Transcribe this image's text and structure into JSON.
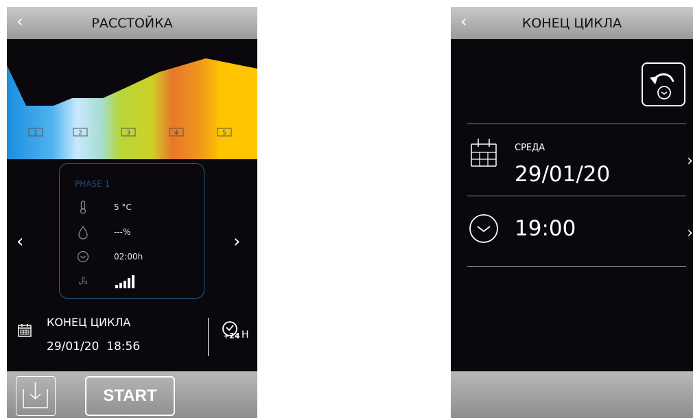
{
  "left_screen": {
    "header": {
      "back_icon": "chevron-left-icon",
      "title": "РАССТОЙКА"
    },
    "profile": {
      "phases": [
        "1",
        "2",
        "3",
        "4",
        "5"
      ],
      "colors": [
        "#1a8fe0",
        "#a8dcff",
        "#b8d63a",
        "#e8772a",
        "#ffc400"
      ]
    },
    "phase_card": {
      "title": "PHASE 1",
      "temperature": "5 °C",
      "humidity": "---%",
      "duration": "02:00h",
      "fan_icon": "fan-icon",
      "fan_level_icon": "signal-bars-icon"
    },
    "end_cycle": {
      "label": "КОНЕЦ ЦИКЛА",
      "date": "29/01/20",
      "time": "18:56",
      "plus24_label": "+24",
      "plus24_unit": "H"
    },
    "footer": {
      "save_icon": "download-icon",
      "start_label": "START"
    }
  },
  "right_screen": {
    "header": {
      "back_icon": "chevron-left-icon",
      "title": "КОНЕЦ ЦИКЛА"
    },
    "reset_icon": "undo-clock-icon",
    "date_row": {
      "day": "СРЕДА",
      "date": "29/01/20",
      "chevron": "›"
    },
    "time_row": {
      "time": "19:00",
      "chevron": "›"
    }
  }
}
